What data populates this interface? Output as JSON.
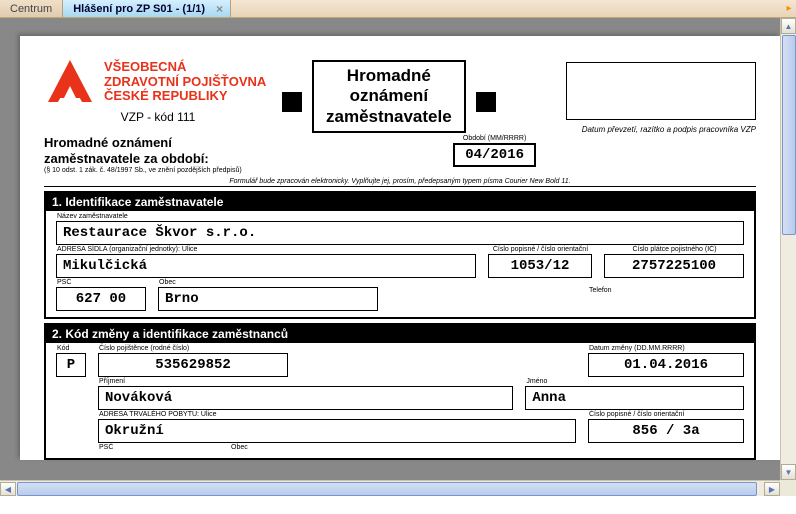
{
  "tabs": {
    "inactive": "Centrum",
    "active": "Hlášení pro ZP S01 - (1/1)"
  },
  "logo": {
    "line1": "VŠEOBECNÁ",
    "line2": "ZDRAVOTNÍ POJIŠŤOVNA",
    "line3": "ČESKÉ REPUBLIKY"
  },
  "vzp_code": "VZP - kód 111",
  "title": {
    "line1": "Hromadné",
    "line2": "oznámení",
    "line3": "zaměstnavatele"
  },
  "receipt_caption": "Datum převzetí, razítko a podpis pracovníka VZP",
  "announce": {
    "line1": "Hromadné oznámení",
    "line2": "zaměstnavatele za období:"
  },
  "legal_text": "(§ 10 odst. 1 zák. č. 48/1997 Sb., ve znění pozdějších předpisů)",
  "period_label": "Období (MM/RRRR)",
  "period": "04/2016",
  "footnote": "Formulář bude zpracován elektronicky. Vyplňujte jej, prosím, předepsaným typem písma Courier New Bold 11.",
  "section1": {
    "title": "1. Identifikace zaměstnavatele",
    "labels": {
      "name": "Název zaměstnavatele",
      "addr": "ADRESA SÍDLA (organizační jednotky): Ulice",
      "cp": "Číslo popisné / číslo orientační",
      "ic": "Číslo plátce pojistného (IČ)",
      "psc": "PSČ",
      "city": "Obec",
      "phone": "Telefon"
    },
    "name": "Restaurace Škvor s.r.o.",
    "addr": "Mikulčická",
    "cp": "1053/12",
    "ic": "2757225100",
    "psc": "627 00",
    "city": "Brno",
    "phone": ""
  },
  "section2": {
    "title": "2. Kód změny a identifikace zaměstnanců",
    "labels": {
      "code": "Kód",
      "rc": "Číslo pojištěnce (rodné číslo)",
      "date": "Datum změny (DD.MM.RRRR)",
      "surname": "Příjmení",
      "firstname": "Jméno",
      "street": "ADRESA TRVALÉHO POBYTU: Ulice",
      "cp": "Číslo popisné / číslo orientační",
      "psc": "PSČ",
      "city": "Obec"
    },
    "code": "P",
    "rc": "535629852",
    "date": "01.04.2016",
    "surname": "Nováková",
    "firstname": "Anna",
    "street": "Okružní",
    "cp": "856 / 3a"
  }
}
